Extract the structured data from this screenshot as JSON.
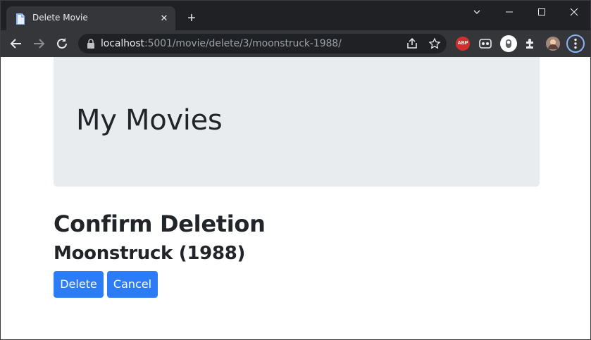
{
  "browser": {
    "tab_title": "Delete Movie",
    "url_host": "localhost",
    "url_rest": ":5001/movie/delete/3/moonstruck-1988/",
    "extension_abp_label": "ABP",
    "icons": [
      "back-icon",
      "forward-icon",
      "reload-icon",
      "lock-icon",
      "share-icon",
      "star-icon",
      "puzzle-icon",
      "menu-icon"
    ],
    "accent": "#8ab4f8"
  },
  "page": {
    "site_title": "My Movies",
    "heading": "Confirm Deletion",
    "movie_title": "Moonstruck (1988)",
    "delete_label": "Delete",
    "cancel_label": "Cancel",
    "button_color": "#2b7cf6",
    "jumbotron_color": "#e9ecef"
  }
}
